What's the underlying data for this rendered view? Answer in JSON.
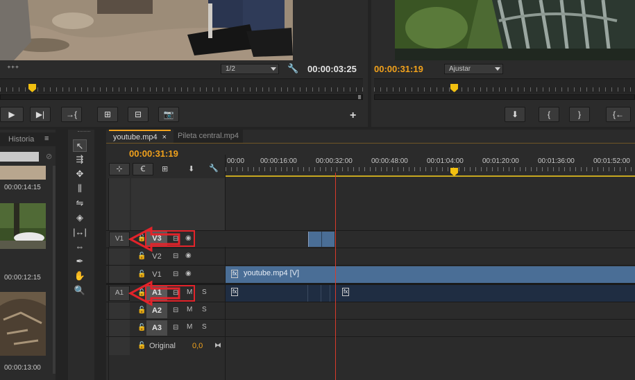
{
  "source_monitor": {
    "timecode": "00:00:03:25",
    "resolution": "1/2",
    "buttons": [
      "mark-in",
      "step-forward",
      "insert",
      "overwrite",
      "export-frame",
      "add"
    ]
  },
  "program_monitor": {
    "timecode": "00:00:31:19",
    "fit": "Ajustar",
    "buttons": [
      "marker",
      "mark-in",
      "mark-out",
      "go-to-in"
    ]
  },
  "project_panel": {
    "tab_label": "Historia",
    "thumb_times": [
      "00:00:14:15",
      "00:00:12:15",
      "00:00:13:00"
    ]
  },
  "timeline": {
    "tabs": [
      {
        "label": "youtube.mp4",
        "close": "×"
      },
      {
        "label": "Pileta central.mp4"
      }
    ],
    "current_time": "00:00:31:19",
    "ruler_labels": [
      "00:00",
      "00:00:16:00",
      "00:00:32:00",
      "00:00:48:00",
      "00:01:04:00",
      "00:01:20:00",
      "00:01:36:00",
      "00:01:52:00"
    ],
    "video_tracks": [
      {
        "src": "V1",
        "name": "V3",
        "targeted": true
      },
      {
        "src": "",
        "name": "V2",
        "targeted": false
      },
      {
        "src": "",
        "name": "V1",
        "targeted": false
      }
    ],
    "audio_tracks": [
      {
        "src": "A1",
        "name": "A1",
        "targeted": true
      },
      {
        "src": "",
        "name": "A2",
        "targeted": false
      },
      {
        "src": "",
        "name": "A3",
        "targeted": false
      }
    ],
    "mute_label": "M",
    "solo_label": "S",
    "master": {
      "label": "Original",
      "value": "0,0"
    },
    "video_clip": {
      "label": "youtube.mp4 [V]",
      "fx": "fx"
    },
    "audio_fx": "fx"
  },
  "colors": {
    "accent_orange": "#f2a21c",
    "clip_blue": "#4a6e96",
    "audio_clip": "#1f2d42",
    "annotation_red": "#e3232a",
    "playhead_red": "#d93b2b"
  }
}
